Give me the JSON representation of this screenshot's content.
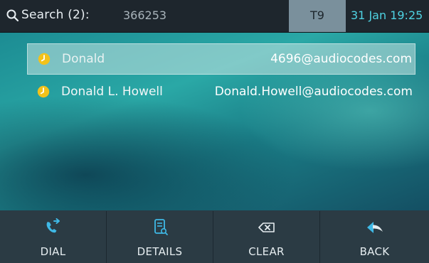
{
  "header": {
    "search_label": "Search (2):",
    "search_value": "366253",
    "mode": "T9",
    "datetime": "31 Jan 19:25"
  },
  "results": [
    {
      "name": "Donald",
      "email": "4696@audiocodes.com",
      "selected": true,
      "icon": "clock-icon"
    },
    {
      "name": "Donald L. Howell",
      "email": "Donald.Howell@audiocodes.com",
      "selected": false,
      "icon": "clock-icon"
    }
  ],
  "softkeys": [
    {
      "label": "DIAL",
      "icon": "dial-icon"
    },
    {
      "label": "DETAILS",
      "icon": "details-icon"
    },
    {
      "label": "CLEAR",
      "icon": "clear-icon"
    },
    {
      "label": "BACK",
      "icon": "back-icon"
    }
  ],
  "colors": {
    "accent": "#4fd3e3",
    "topbar": "#1e262d",
    "t9_bg": "#7a909c",
    "softbar": "#2b3b44",
    "clock_icon": "#f2c21b"
  }
}
